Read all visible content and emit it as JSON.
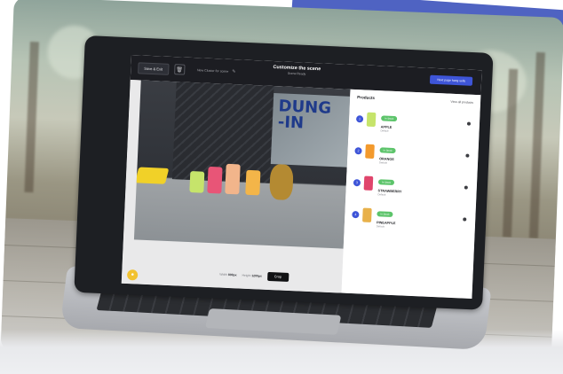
{
  "colors": {
    "accent": "#3e55d8",
    "badge_green": "#5dc46b",
    "topbar": "#1c1d22",
    "brand_yellow": "#f2c230"
  },
  "app": {
    "save_exit": "Save & Exit",
    "trash_icon": "trash-icon",
    "scene_name": "New Cluster for scene",
    "title": "Customize the scene",
    "subtitle": "Scene Ready",
    "cta": "Next page hang sells"
  },
  "canvas": {
    "poster_text": "DUNG\n-IN",
    "width_label": "Width",
    "width_value": "800px",
    "height_label": "Height",
    "height_value": "1200px",
    "crop_label": "Crop"
  },
  "panel": {
    "title": "Products",
    "view_all": "View all products",
    "items": [
      {
        "num": "1",
        "badge": "In Stock",
        "name": "APPLE",
        "variant": "Default",
        "color": "#6aa84f"
      },
      {
        "num": "2",
        "badge": "In Stock",
        "name": "ORANGE",
        "variant": "Default",
        "color": "#f39a2d"
      },
      {
        "num": "3",
        "badge": "In Stock",
        "name": "STRAWBERRY",
        "variant": "Default",
        "color": "#e0456c"
      },
      {
        "num": "4",
        "badge": "In Stock",
        "name": "PINEAPPLE",
        "variant": "Default",
        "color": "#e8b14a"
      }
    ]
  }
}
